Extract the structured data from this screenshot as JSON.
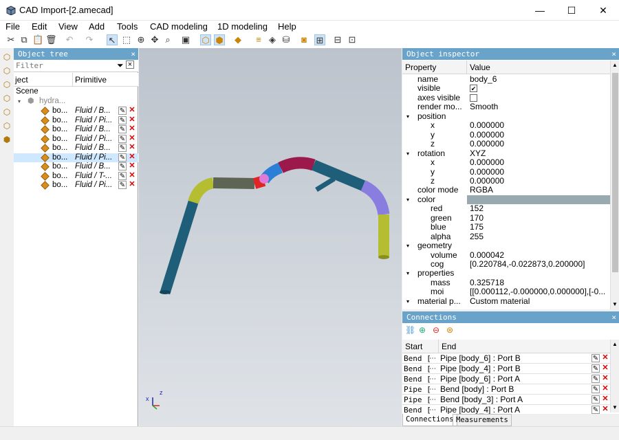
{
  "window": {
    "title": "CAD Import-[2.amecad]",
    "minimize": "—",
    "maximize": "☐",
    "close": "✕"
  },
  "menu": [
    "File",
    "Edit",
    "View",
    "Add",
    "Tools",
    "CAD modeling",
    "1D modeling",
    "Help"
  ],
  "object_tree": {
    "header": "Object tree",
    "filter_placeholder": "Filter",
    "col_object": "ject",
    "col_primitive": "Primitive",
    "scene": "Scene",
    "root": "hydra...",
    "items": [
      {
        "name": "bo...",
        "primitive": "Fluid / B..."
      },
      {
        "name": "bo...",
        "primitive": "Fluid / Pi..."
      },
      {
        "name": "bo...",
        "primitive": "Fluid / B..."
      },
      {
        "name": "bo...",
        "primitive": "Fluid / Pi..."
      },
      {
        "name": "bo...",
        "primitive": "Fluid / B..."
      },
      {
        "name": "bo...",
        "primitive": "Fluid / Pi..."
      },
      {
        "name": "bo...",
        "primitive": "Fluid / B..."
      },
      {
        "name": "bo...",
        "primitive": "Fluid / T-..."
      },
      {
        "name": "bo...",
        "primitive": "Fluid / Pi..."
      }
    ]
  },
  "inspector": {
    "header": "Object inspector",
    "col_property": "Property",
    "col_value": "Value",
    "rows": [
      {
        "k": "name",
        "v": "body_6",
        "lvl": 1
      },
      {
        "k": "visible",
        "v": "✔",
        "lvl": 1,
        "box": true
      },
      {
        "k": "axes visible",
        "v": "",
        "lvl": 1,
        "box": true
      },
      {
        "k": "render mo...",
        "v": "Smooth",
        "lvl": 1
      },
      {
        "k": "position",
        "v": "",
        "lvl": 0,
        "exp": true
      },
      {
        "k": "x",
        "v": "0.000000",
        "lvl": 2
      },
      {
        "k": "y",
        "v": "0.000000",
        "lvl": 2
      },
      {
        "k": "z",
        "v": "0.000000",
        "lvl": 2
      },
      {
        "k": "rotation",
        "v": "XYZ",
        "lvl": 0,
        "exp": true
      },
      {
        "k": "x",
        "v": "0.000000",
        "lvl": 2
      },
      {
        "k": "y",
        "v": "0.000000",
        "lvl": 2
      },
      {
        "k": "z",
        "v": "0.000000",
        "lvl": 2
      },
      {
        "k": "color mode",
        "v": "RGBA",
        "lvl": 1
      },
      {
        "k": "color",
        "v": "",
        "lvl": 0,
        "exp": true,
        "swatch": "#98aaaf"
      },
      {
        "k": "red",
        "v": "152",
        "lvl": 2
      },
      {
        "k": "green",
        "v": "170",
        "lvl": 2
      },
      {
        "k": "blue",
        "v": "175",
        "lvl": 2
      },
      {
        "k": "alpha",
        "v": "255",
        "lvl": 2
      },
      {
        "k": "geometry",
        "v": "",
        "lvl": 0,
        "exp": true
      },
      {
        "k": "volume",
        "v": "0.000042",
        "lvl": 2
      },
      {
        "k": "cog",
        "v": "[0.220784,-0.022873,0.200000]",
        "lvl": 2
      },
      {
        "k": "properties",
        "v": "",
        "lvl": 0,
        "exp": true
      },
      {
        "k": "mass",
        "v": "0.325718",
        "lvl": 2
      },
      {
        "k": "moi",
        "v": "[[0.000112,-0.000000,0.000000],[-0...",
        "lvl": 2
      },
      {
        "k": "material p...",
        "v": "Custom material",
        "lvl": 0,
        "exp": true
      }
    ]
  },
  "connections": {
    "header": "Connections",
    "col_start": "Start",
    "col_end": "End",
    "rows": [
      {
        "start": "Bend [",
        "end": "Pipe [body_6] : Port B"
      },
      {
        "start": "Bend [",
        "end": "Pipe [body_4] : Port B"
      },
      {
        "start": "Bend [",
        "end": "Pipe [body_6] : Port A"
      },
      {
        "start": "Pipe [",
        "end": "Bend [body] : Port B"
      },
      {
        "start": "Pipe [",
        "end": "Bend [body_3] : Port A"
      },
      {
        "start": "Bend [",
        "end": "Pipe [body_4] : Port A"
      }
    ]
  },
  "tabs": [
    "Connections",
    "Measurements"
  ],
  "colors": {
    "accent": "#6aa3c9",
    "pipe_teal": "#1f5e78",
    "pipe_olive": "#b5bd30",
    "pipe_gray": "#5f6555",
    "pipe_red": "#e02525",
    "pipe_blue": "#2b7fd6",
    "pipe_crimson": "#9b1a4b",
    "pipe_violet": "#8a7de0"
  }
}
